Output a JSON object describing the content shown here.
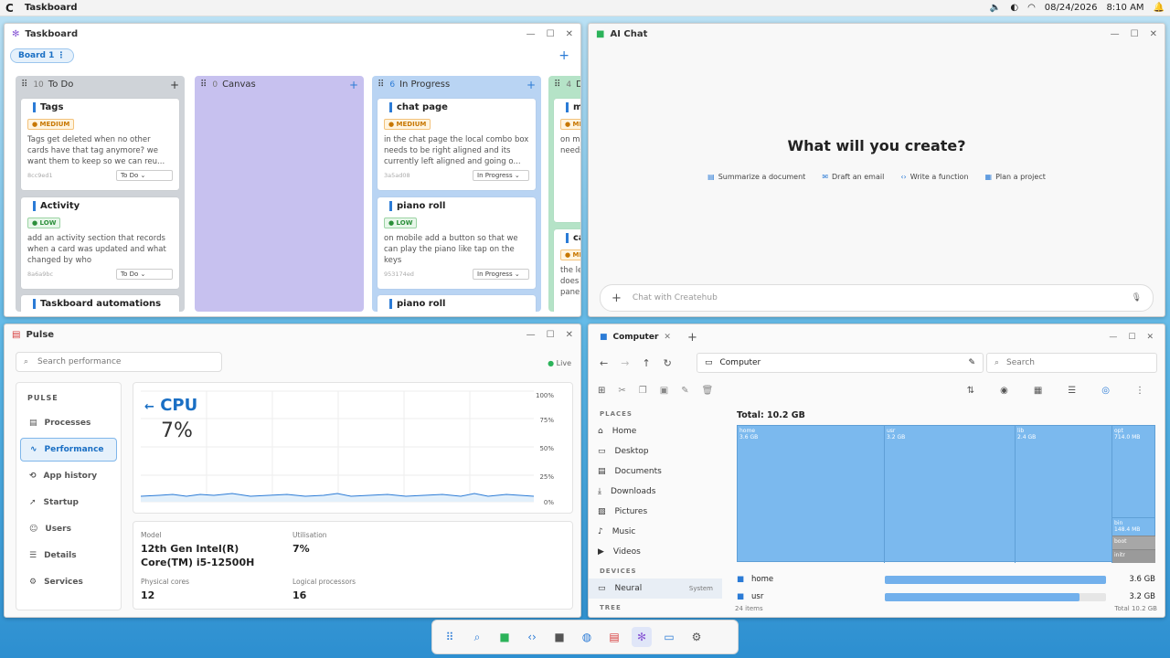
{
  "topbar": {
    "logo": "C",
    "app": "Taskboard",
    "date": "08/24/2026",
    "time": "8:10 AM"
  },
  "taskboard": {
    "title": "Taskboard",
    "board_tab": "Board 1",
    "columns": [
      {
        "name": "To Do",
        "count": "10",
        "bg": "#cfd3d8"
      },
      {
        "name": "Canvas",
        "count": "0",
        "bg": "#c7c1ef"
      },
      {
        "name": "In Progress",
        "count": "6",
        "bg": "#b9d4f3"
      },
      {
        "name": "Do",
        "count": "4",
        "bg": "#b5e3c7"
      }
    ],
    "cards": [
      {
        "title": "Tags",
        "priority": "MEDIUM",
        "desc": "Tags get deleted when no other cards have that tag anymore? we want them to keep so we can reu...",
        "hash": "8cc9ed1",
        "status": "To Do"
      },
      {
        "title": "Activity",
        "priority": "LOW",
        "desc": "add an activity section that records when a card was updated and what changed by who",
        "hash": "8a6a9bc",
        "status": "To Do"
      },
      {
        "title": "Taskboard automations"
      },
      {
        "title": "chat page",
        "priority": "MEDIUM",
        "desc": "in the chat page the local combo box needs to be right aligned and its currently left aligned and going o...",
        "hash": "3a5ad08",
        "status": "In Progress"
      },
      {
        "title": "piano roll",
        "priority": "LOW",
        "desc": "on mobile add a button so that we can play the piano like tap on the keys",
        "hash": "953174ed",
        "status": "In Progress"
      },
      {
        "title": "piano roll"
      },
      {
        "title": "me",
        "priority": "MED",
        "desc": "on mob needs"
      },
      {
        "title": "ca",
        "priority": "MED",
        "desc": "the left does n panel o"
      }
    ]
  },
  "aichat": {
    "title": "AI Chat",
    "headline": "What will you create?",
    "chips": [
      "Summarize a document",
      "Draft an email",
      "Write a function",
      "Plan a project"
    ],
    "placeholder": "Chat with Createhub"
  },
  "pulse": {
    "title": "Pulse",
    "search_placeholder": "Search performance",
    "live": "Live",
    "section": "PULSE",
    "nav": [
      "Processes",
      "Performance",
      "App history",
      "Startup",
      "Users",
      "Details",
      "Services"
    ],
    "cpu_title": "CPU",
    "cpu_value": "7%",
    "y_ticks": [
      "100%",
      "75%",
      "50%",
      "25%",
      "0%"
    ],
    "info": {
      "model_label": "Model",
      "model": "12th Gen Intel(R) Core(TM) i5-12500H",
      "util_label": "Utilisation",
      "util": "7%",
      "phys_label": "Physical cores",
      "phys": "12",
      "log_label": "Logical processors",
      "log": "16"
    }
  },
  "computer": {
    "tab": "Computer",
    "path": "Computer",
    "search_placeholder": "Search",
    "places_header": "PLACES",
    "places": [
      "Home",
      "Desktop",
      "Documents",
      "Downloads",
      "Pictures",
      "Music",
      "Videos"
    ],
    "devices_header": "DEVICES",
    "device": "Neural",
    "device_tag": "System",
    "tree_header": "TREE",
    "total": "Total: 10.2 GB",
    "tm": [
      {
        "n": "home",
        "s": "3.6 GB"
      },
      {
        "n": "usr",
        "s": "3.2 GB"
      },
      {
        "n": "lib",
        "s": "2.4 GB"
      },
      {
        "n": "opt",
        "s": "714.0 MB"
      }
    ],
    "tm_small": [
      {
        "n": "bin",
        "s": "148.4 MB"
      },
      {
        "n": "boot"
      },
      {
        "n": "initr"
      }
    ],
    "rows": [
      {
        "n": "home",
        "s": "3.6 GB",
        "pct": 100
      },
      {
        "n": "usr",
        "s": "3.2 GB",
        "pct": 88
      }
    ],
    "items": "24 items",
    "footer_total": "Total 10.2 GB"
  }
}
